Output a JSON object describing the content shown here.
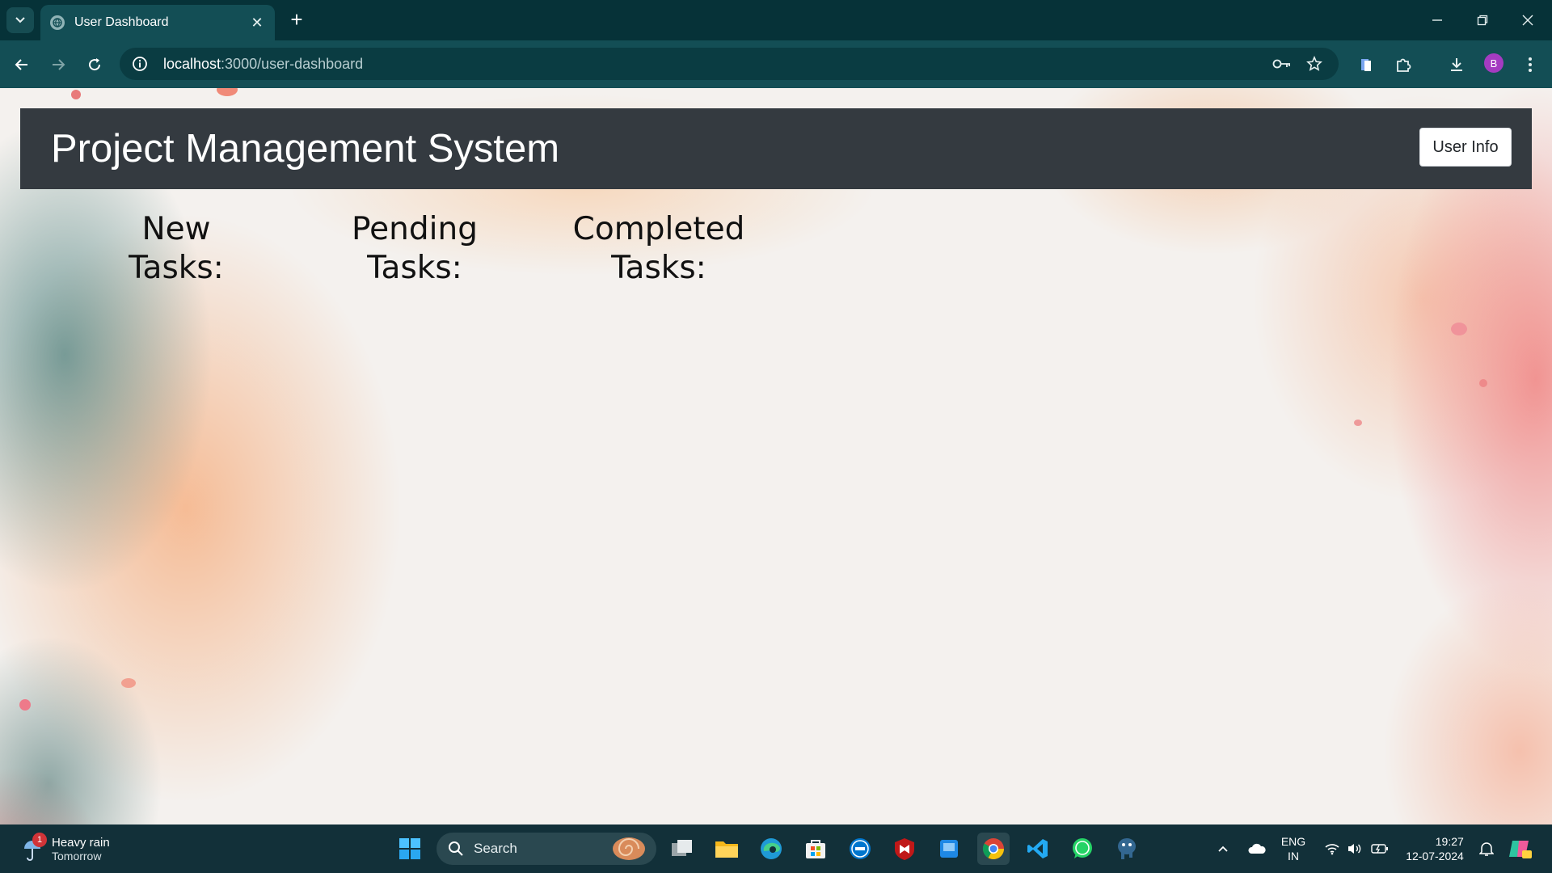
{
  "browser": {
    "tab_title": "User Dashboard",
    "new_tab": "+",
    "tab_close": "✕",
    "url_host": "localhost",
    "url_path": ":3000/user-dashboard",
    "profile_initial": "B"
  },
  "navbar": {
    "brand": "Project Management System",
    "user_info_button": "User Info"
  },
  "task_columns": [
    {
      "line1": "New",
      "line2": "Tasks:"
    },
    {
      "line1": "Pending",
      "line2": "Tasks:"
    },
    {
      "line1": "Completed",
      "line2": "Tasks:"
    }
  ],
  "taskbar": {
    "weather_title": "Heavy rain",
    "weather_sub": "Tomorrow",
    "weather_badge": "1",
    "search_placeholder": "Search",
    "lang_line1": "ENG",
    "lang_line2": "IN",
    "time": "19:27",
    "date": "12-07-2024"
  },
  "colors": {
    "navbar_bg": "#343a40",
    "chrome_toolbar": "#134e55",
    "chrome_tabbar": "#063238",
    "taskbar_bg": "#123039",
    "avatar": "#a43bc1"
  }
}
